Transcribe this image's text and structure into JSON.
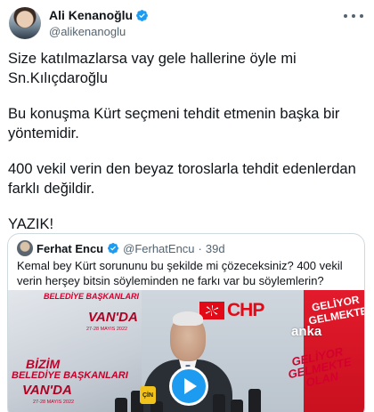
{
  "author": {
    "name": "Ali Kenanoğlu",
    "handle": "@alikenanoglu",
    "verified": true,
    "verified_icon": "verified-badge-icon",
    "more_icon": "more-options-icon"
  },
  "tweet": {
    "paragraphs": [
      "Size katılmazlarsa vay gele hallerine öyle mi\nSn.Kılıçdaroğlu",
      "Bu konuşma Kürt seçmeni tehdit etmenin başka bir\nyöntemidir.",
      "400 vekil verin den beyaz toroslarla tehdit edenlerdan\nfarklı değildir.",
      "YAZIK!"
    ]
  },
  "quote": {
    "name": "Ferhat Encu",
    "verified": true,
    "handle": "@FerhatEncu",
    "dot": "·",
    "time": "39d",
    "text": "Kemal bey Kürt sorununu bu şekilde mi çözeceksiniz?  400 vekil verin herşey bitsin söyleminden ne farkı var bu söylemlerin?",
    "media": {
      "type": "video",
      "play_icon": "play-icon",
      "sign_top_line": "BELEDİYE BAŞKANLARI",
      "sign_top_van": "VAN'DA",
      "sign_top_date": "27-28 MAYIS 2022",
      "bizim": "BİZİM",
      "bizim_sub": "BELEDİYE BAŞKANLARI",
      "bizim_van": "VAN'DA",
      "bizim_date": "27-28 MAYIS 2022",
      "chp": "CHP",
      "gel_top": "GELİYOR GELMEKTE",
      "anka": "anka",
      "gel_bottom": "GELİYOR GELMEKTE OLAN",
      "mic_label": "ÇİN"
    }
  },
  "colors": {
    "accent": "#1d9bf0",
    "text": "#0f1419",
    "secondary": "#536471",
    "border": "#cfd9de",
    "chp_red": "#e30a17"
  }
}
